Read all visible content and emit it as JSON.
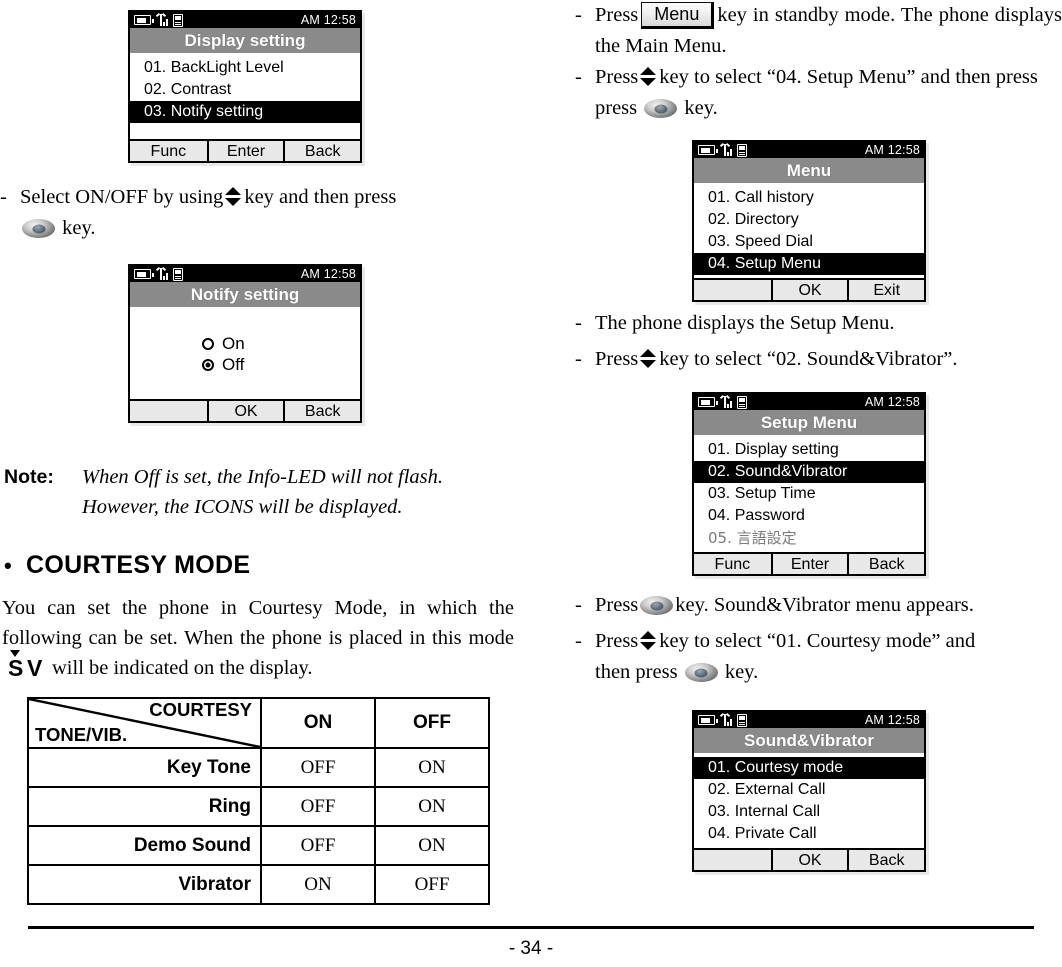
{
  "page": {
    "number": "- 34 -"
  },
  "icons": {
    "nav_updown": "up-down-key-icon",
    "ok_key": "ok-key-icon",
    "menu_key_label": "Menu"
  },
  "left_column": {
    "screen1": {
      "status": {
        "clock": "AM 12:58"
      },
      "title": "Display setting",
      "items": [
        {
          "label": "01. BackLight Level",
          "selected": false
        },
        {
          "label": "02. Contrast",
          "selected": false
        },
        {
          "label": "03. Notify setting",
          "selected": true
        }
      ],
      "softkeys": [
        "Func",
        "Enter",
        "Back"
      ]
    },
    "step_select": {
      "dash": "-",
      "text_a": "Select ON/OFF by using",
      "text_b": "key and then press",
      "text_c": "key."
    },
    "screen2": {
      "status": {
        "clock": "AM 12:58"
      },
      "title": "Notify setting",
      "options": [
        {
          "label": "On",
          "checked": false
        },
        {
          "label": "Off",
          "checked": true
        }
      ],
      "softkeys": [
        "",
        "OK",
        "Back"
      ]
    },
    "note": {
      "label": "Note:",
      "line1": "When Off is set, the Info-LED will not flash.",
      "line2": "However, the ICONS will be displayed."
    },
    "section": {
      "bullet": "•",
      "heading": "COURTESY MODE",
      "para_a": "You can set the phone in Courtesy Mode, in which the following can be set. When the phone is placed in this mode",
      "glyph_s": "S",
      "glyph_v": "V",
      "para_b": "will be indicated on the display."
    },
    "table": {
      "corner_topright": "COURTESY",
      "corner_botleft": "TONE/VIB.",
      "columns": [
        "ON",
        "OFF"
      ],
      "rows": [
        {
          "label": "Key Tone",
          "values": [
            "OFF",
            "ON"
          ]
        },
        {
          "label": "Ring",
          "values": [
            "OFF",
            "ON"
          ]
        },
        {
          "label": "Demo Sound",
          "values": [
            "OFF",
            "ON"
          ]
        },
        {
          "label": "Vibrator",
          "values": [
            "ON",
            "OFF"
          ]
        }
      ]
    }
  },
  "right_column": {
    "step_menu": {
      "dash": "-",
      "text_a": "Press",
      "text_b": "key in standby mode. The phone displays the Main Menu."
    },
    "step_setup": {
      "dash": "-",
      "text_a": "Press",
      "text_b": "key to select “04. Setup Menu” and then press",
      "text_c": "key."
    },
    "screen3": {
      "status": {
        "clock": "AM 12:58"
      },
      "title": "Menu",
      "items": [
        {
          "label": "01. Call history",
          "selected": false
        },
        {
          "label": "02. Directory",
          "selected": false
        },
        {
          "label": "03. Speed Dial",
          "selected": false
        },
        {
          "label": "04. Setup Menu",
          "selected": true
        }
      ],
      "softkeys": [
        "",
        "OK",
        "Exit"
      ]
    },
    "step_displays": {
      "dash": "-",
      "text_a": "The phone displays the Setup Menu."
    },
    "step_sound": {
      "dash": "-",
      "text_a": "Press",
      "text_b": "key to select “02. Sound&Vibrator”."
    },
    "screen4": {
      "status": {
        "clock": "AM 12:58"
      },
      "title": "Setup Menu",
      "items": [
        {
          "label": "01. Display setting",
          "selected": false
        },
        {
          "label": "02. Sound&Vibrator",
          "selected": true
        },
        {
          "label": "03. Setup Time",
          "selected": false
        },
        {
          "label": "04. Password",
          "selected": false
        },
        {
          "label": "05. 言語設定",
          "selected": false
        }
      ],
      "softkeys": [
        "Func",
        "Enter",
        "Back"
      ]
    },
    "step_appears": {
      "dash": "-",
      "text_a": "Press",
      "text_b": "key. Sound&Vibrator menu appears."
    },
    "step_courtesy": {
      "dash": "-",
      "text_a": "Press",
      "text_b": "key to select “01. Courtesy mode” and then press",
      "text_c": "key."
    },
    "screen5": {
      "status": {
        "clock": "AM 12:58"
      },
      "title": "Sound&Vibrator",
      "items": [
        {
          "label": "01. Courtesy mode",
          "selected": true
        },
        {
          "label": "02. External Call",
          "selected": false
        },
        {
          "label": "03. Internal Call",
          "selected": false
        },
        {
          "label": "04. Private Call",
          "selected": false
        }
      ],
      "softkeys": [
        "",
        "OK",
        "Back"
      ]
    }
  }
}
